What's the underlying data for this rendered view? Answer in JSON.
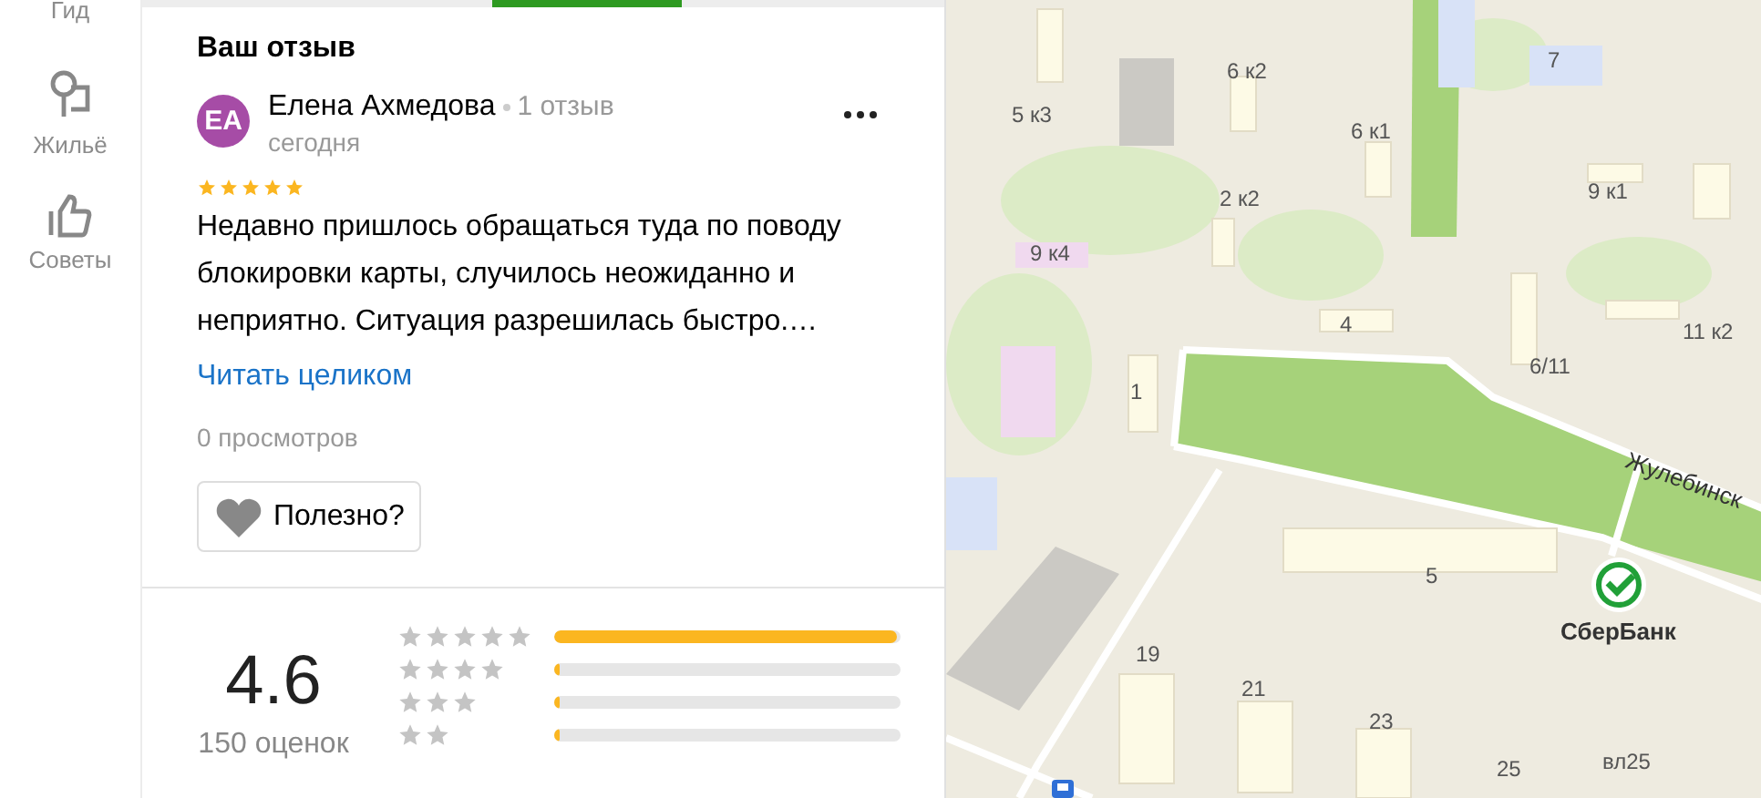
{
  "sidebar": {
    "items": [
      {
        "label": "Гид",
        "kind": "guide"
      },
      {
        "label": "Жильё",
        "kind": "housing"
      },
      {
        "label": "Советы",
        "kind": "tips"
      }
    ]
  },
  "review": {
    "title": "Ваш отзыв",
    "author": {
      "initials": "ЕА",
      "name": "Елена Ахмедова",
      "reviews_count": "1 отзыв",
      "date": "сегодня"
    },
    "stars": 5,
    "text": "Недавно пришлось обращаться туда по поводу блокировки карты, случилось неожиданно и неприятно. Ситуация разрешилась быстро.…",
    "read_more": "Читать целиком",
    "views": "0 просмотров",
    "helpful_button": "Полезно?"
  },
  "rating": {
    "score": "4.6",
    "count": "150 оценок",
    "rows": [
      {
        "level": 0.99
      },
      {
        "level": 0.01
      },
      {
        "level": 0.01
      },
      {
        "level": 0.01
      }
    ]
  },
  "map": {
    "labels": [
      "5 к3",
      "6 к2",
      "7",
      "6 к1",
      "2 к2",
      "9 к1",
      "9 к4",
      "4",
      "11 к2",
      "6/11",
      "1",
      "Жулебинск",
      "5",
      "19",
      "21",
      "23",
      "25",
      "вл25"
    ],
    "poi": {
      "name": "СберБанк"
    }
  }
}
